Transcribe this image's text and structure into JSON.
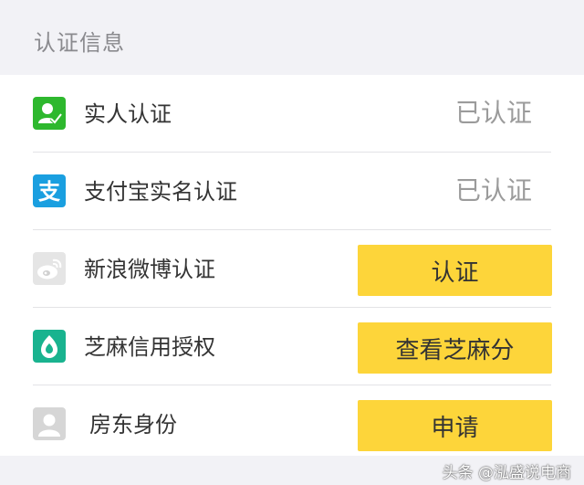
{
  "section": {
    "title": "认证信息"
  },
  "rows": [
    {
      "label": "实人认证",
      "status": "已认证",
      "icon": "person-verify-icon",
      "icon_color": "#2eb82e"
    },
    {
      "label": "支付宝实名认证",
      "status": "已认证",
      "icon": "alipay-icon",
      "icon_color": "#1a9fe0"
    },
    {
      "label": "新浪微博认证",
      "button": "认证",
      "icon": "weibo-icon",
      "icon_color": "#e5e5e5"
    },
    {
      "label": "芝麻信用授权",
      "button": "查看芝麻分",
      "icon": "sesame-credit-icon",
      "icon_color": "#19b38f"
    },
    {
      "label": "房东身份",
      "button": "申请",
      "icon": "landlord-avatar-icon",
      "icon_color": "#d6d6d6"
    }
  ],
  "colors": {
    "button_bg": "#fdd53a",
    "status_text": "#9b9b9b",
    "background": "#f2f2f6"
  },
  "watermark": "头条 @泓盛说电商"
}
